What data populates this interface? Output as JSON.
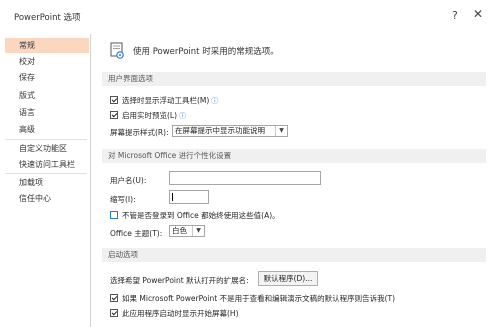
{
  "window": {
    "title": "PowerPoint 选项",
    "help_label": "?",
    "close_label": "✕"
  },
  "sidebar": {
    "items": [
      {
        "label": "常规"
      },
      {
        "label": "校对"
      },
      {
        "label": "保存"
      },
      {
        "label": "版式"
      },
      {
        "label": "语言"
      },
      {
        "label": "高级"
      },
      {
        "label": "自定义功能区"
      },
      {
        "label": "快速访问工具栏"
      },
      {
        "label": "加载项"
      },
      {
        "label": "信任中心"
      }
    ],
    "active_index": 0
  },
  "main": {
    "header": "使用 PowerPoint 时采用的常规选项。",
    "ui_section": {
      "title": "用户界面选项",
      "mini_toolbar": {
        "label": "选择时显示浮动工具栏(M)",
        "checked": true
      },
      "live_preview": {
        "label": "启用实时预览(L)",
        "checked": true
      },
      "screentip": {
        "label": "屏幕提示样式(R):",
        "value": "在屏幕提示中显示功能说明"
      }
    },
    "personalize_section": {
      "title": "对 Microsoft Office 进行个性化设置",
      "username_label": "用户名(U):",
      "username_value": "",
      "initials_label": "缩写(I):",
      "initials_value": "",
      "always_use": {
        "label": "不管是否登录到 Office 都始终使用这些值(A)。",
        "checked": false
      },
      "theme_label": "Office 主题(T):",
      "theme_value": "白色"
    },
    "startup_section": {
      "title": "启动选项",
      "extensions_label": "选择希望 PowerPoint 默认打开的扩展名:",
      "default_programs_button": "默认程序(D)...",
      "tell_me": {
        "label": "如果 Microsoft PowerPoint 不是用于查看和编辑演示文稿的默认程序则告诉我(T)",
        "checked": true
      },
      "show_start_screen": {
        "label": "此应用程序启动时显示开始屏幕(H)",
        "checked": true
      }
    }
  },
  "colors": {
    "active_nav": "#fbd7c0",
    "accent": "#2b7bd3",
    "section_bg": "#f0f0f0"
  }
}
